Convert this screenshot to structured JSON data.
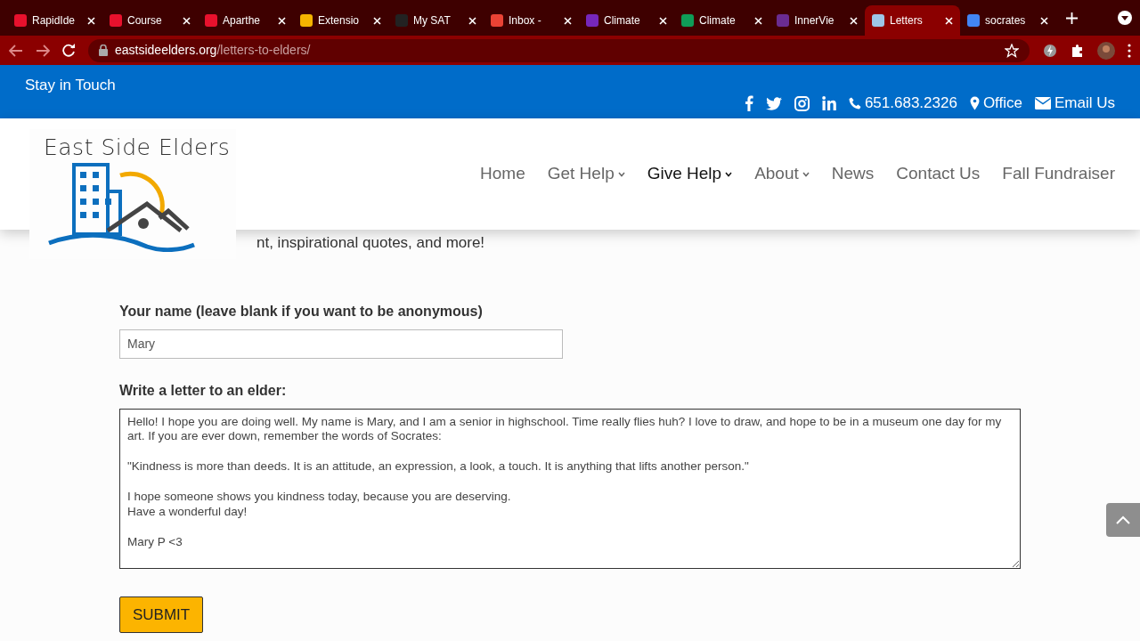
{
  "browser": {
    "tabs": [
      {
        "title": "RapidIde",
        "color": "#e8112d",
        "selected": false
      },
      {
        "title": "Course",
        "color": "#e8112d",
        "selected": false
      },
      {
        "title": "Aparthe",
        "color": "#e8112d",
        "selected": false
      },
      {
        "title": "Extensio",
        "color": "#f4b400",
        "selected": false
      },
      {
        "title": "My SAT",
        "color": "#222222",
        "selected": false
      },
      {
        "title": "Inbox -",
        "color": "#ea4335",
        "selected": false
      },
      {
        "title": "Climate",
        "color": "#7627bb",
        "selected": false
      },
      {
        "title": "Climate",
        "color": "#0f9d58",
        "selected": false
      },
      {
        "title": "InnerVie",
        "color": "#6a2c91",
        "selected": false
      },
      {
        "title": "Letters",
        "color": "#9ec6e8",
        "selected": true
      },
      {
        "title": "socrates",
        "color": "#4285f4",
        "selected": false
      }
    ],
    "url_domain": "eastsideelders.org",
    "url_path": "/letters-to-elders/"
  },
  "top_bar": {
    "title": "Stay in Touch",
    "phone": "651.683.2326",
    "office": "Office",
    "email": "Email Us"
  },
  "logo": {
    "text": "East Side Elders"
  },
  "nav": [
    {
      "label": "Home",
      "dropdown": false,
      "selected": false
    },
    {
      "label": "Get Help",
      "dropdown": true,
      "selected": false
    },
    {
      "label": "Give Help",
      "dropdown": true,
      "selected": true
    },
    {
      "label": "About",
      "dropdown": true,
      "selected": false
    },
    {
      "label": "News",
      "dropdown": false,
      "selected": false
    },
    {
      "label": "Contact Us",
      "dropdown": false,
      "selected": false
    },
    {
      "label": "Fall Fundraiser",
      "dropdown": false,
      "selected": false
    }
  ],
  "intro": "nt, inspirational quotes, and more!",
  "form": {
    "name_label": "Your name (leave blank if you want to be anonymous)",
    "name_value": "Mary",
    "letter_label": "Write a letter to an elder:",
    "letter_value": "Hello! I hope you are doing well. My name is Mary, and I am a senior in highschool. Time really flies huh? I love to draw, and hope to be in a museum one day for my art. If you are ever down, remember the words of Socrates:\n\n\"Kindness is more than deeds. It is an attitude, an expression, a look, a touch. It is anything that lifts another person.\"\n\nI hope someone shows you kindness today, because you are deserving.\nHave a wonderful day!\n\nMary P <3",
    "submit": "SUBMIT"
  }
}
